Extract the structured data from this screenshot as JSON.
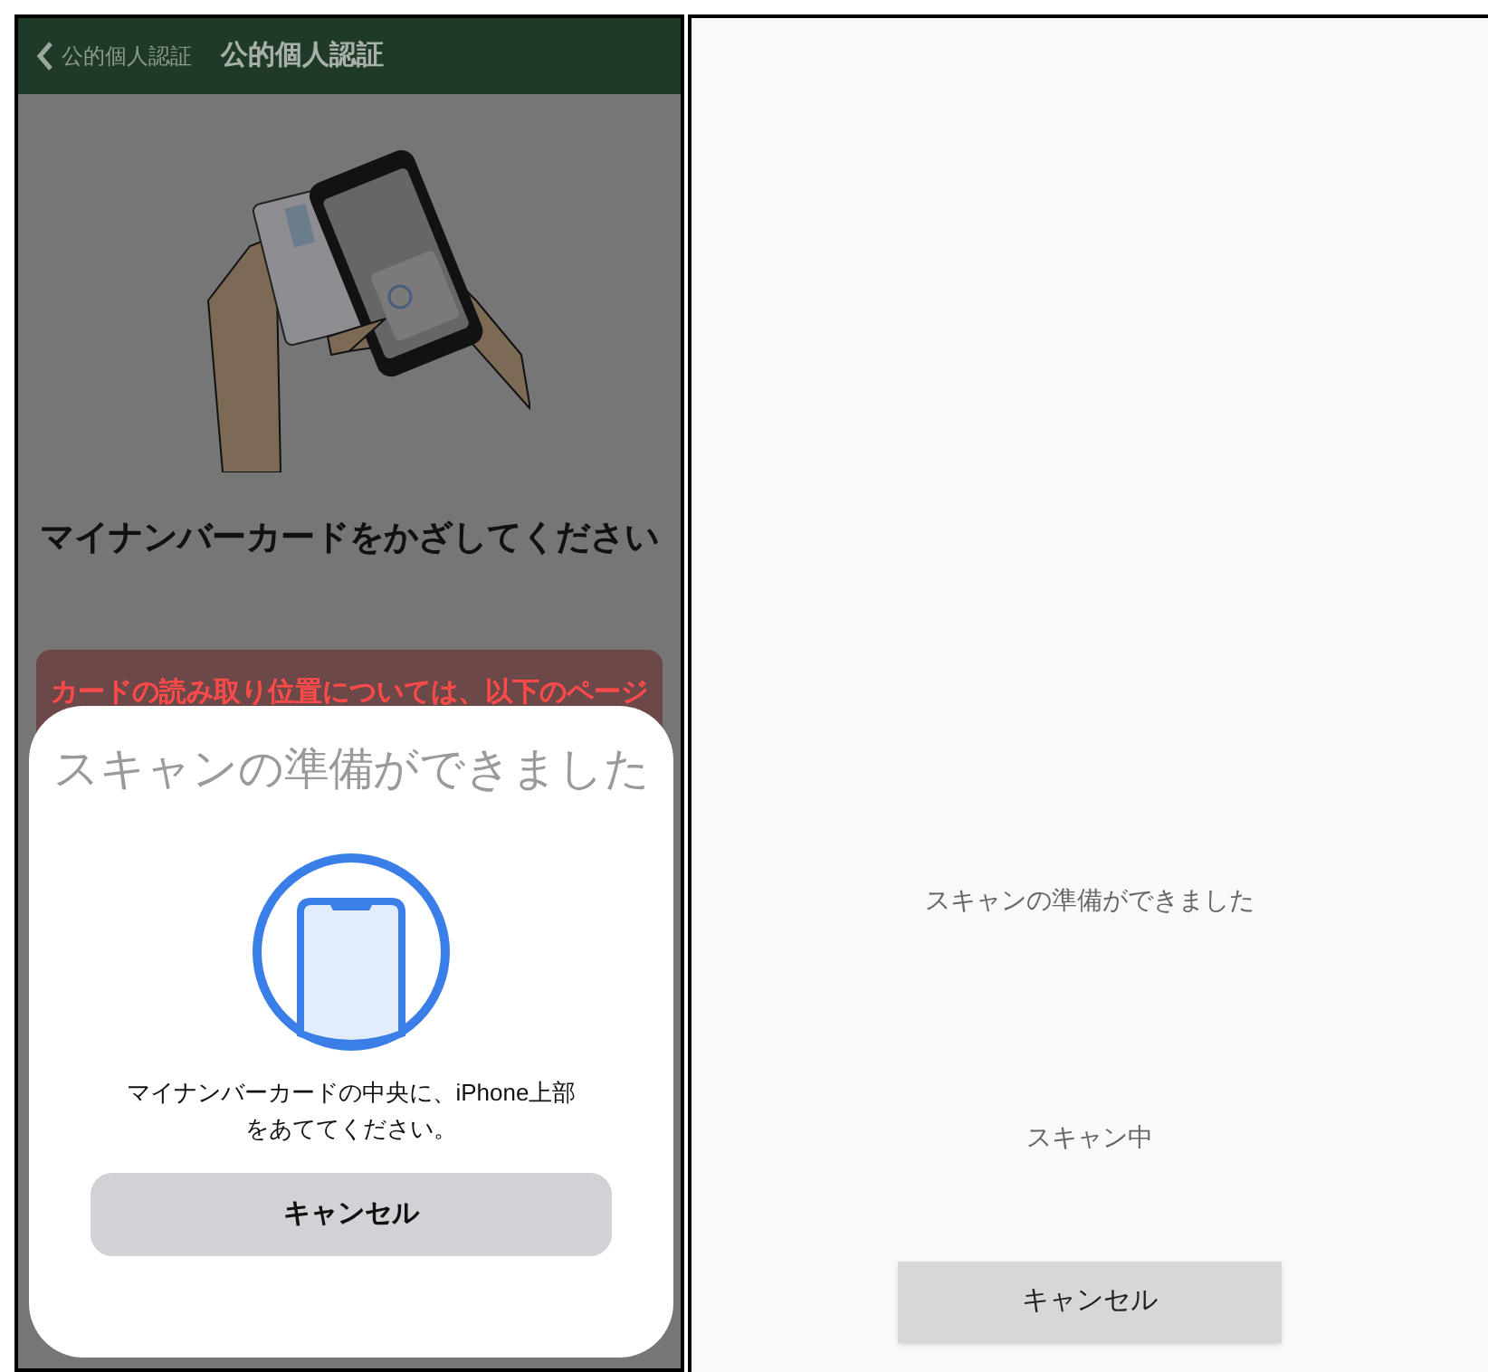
{
  "left_screen": {
    "header": {
      "back_label": "公的個人認証",
      "title": "公的個人認証"
    },
    "instruction": "マイナンバーカードをかざしてください",
    "notice": "カードの読み取り位置については、以下のページ",
    "scan_sheet": {
      "title": "スキャンの準備ができました",
      "message": "マイナンバーカードの中央に、iPhone上部をあててください。",
      "cancel_button": "キャンセル"
    }
  },
  "right_screen": {
    "status": "スキャンの準備ができました",
    "progress": "スキャン中",
    "cancel_button": "キャンセル"
  }
}
